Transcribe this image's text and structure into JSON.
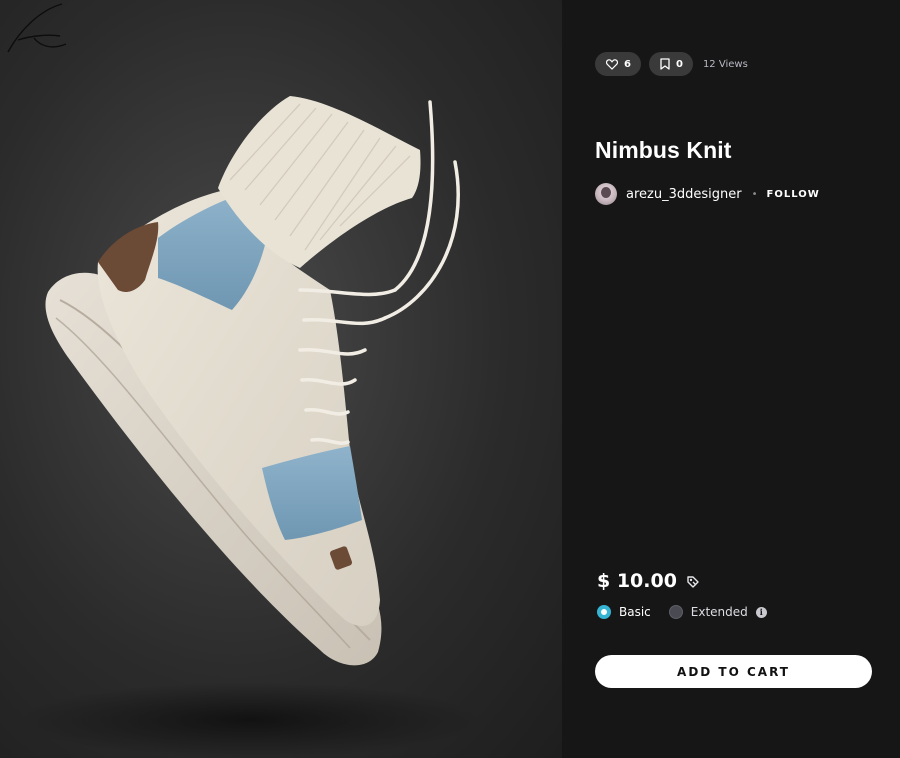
{
  "stats": {
    "likes": "6",
    "saves": "0",
    "views": "12 Views"
  },
  "product": {
    "title": "Nimbus Knit",
    "author": "arezu_3ddesigner",
    "separator": "•",
    "follow_label": "FOLLOW",
    "price": "$ 10.00"
  },
  "license": {
    "options": [
      {
        "label": "Basic",
        "selected": true
      },
      {
        "label": "Extended",
        "selected": false
      }
    ],
    "info_glyph": "i"
  },
  "cart": {
    "label": "ADD TO CART"
  },
  "icons": {
    "like": "heart-icon",
    "save": "bookmark-icon",
    "license": "license-icon",
    "info": "info-icon"
  },
  "colors": {
    "panel_bg": "#161616",
    "pill_bg": "#3a3a3a",
    "accent": "#36b4d3",
    "button_bg": "#ffffff"
  }
}
